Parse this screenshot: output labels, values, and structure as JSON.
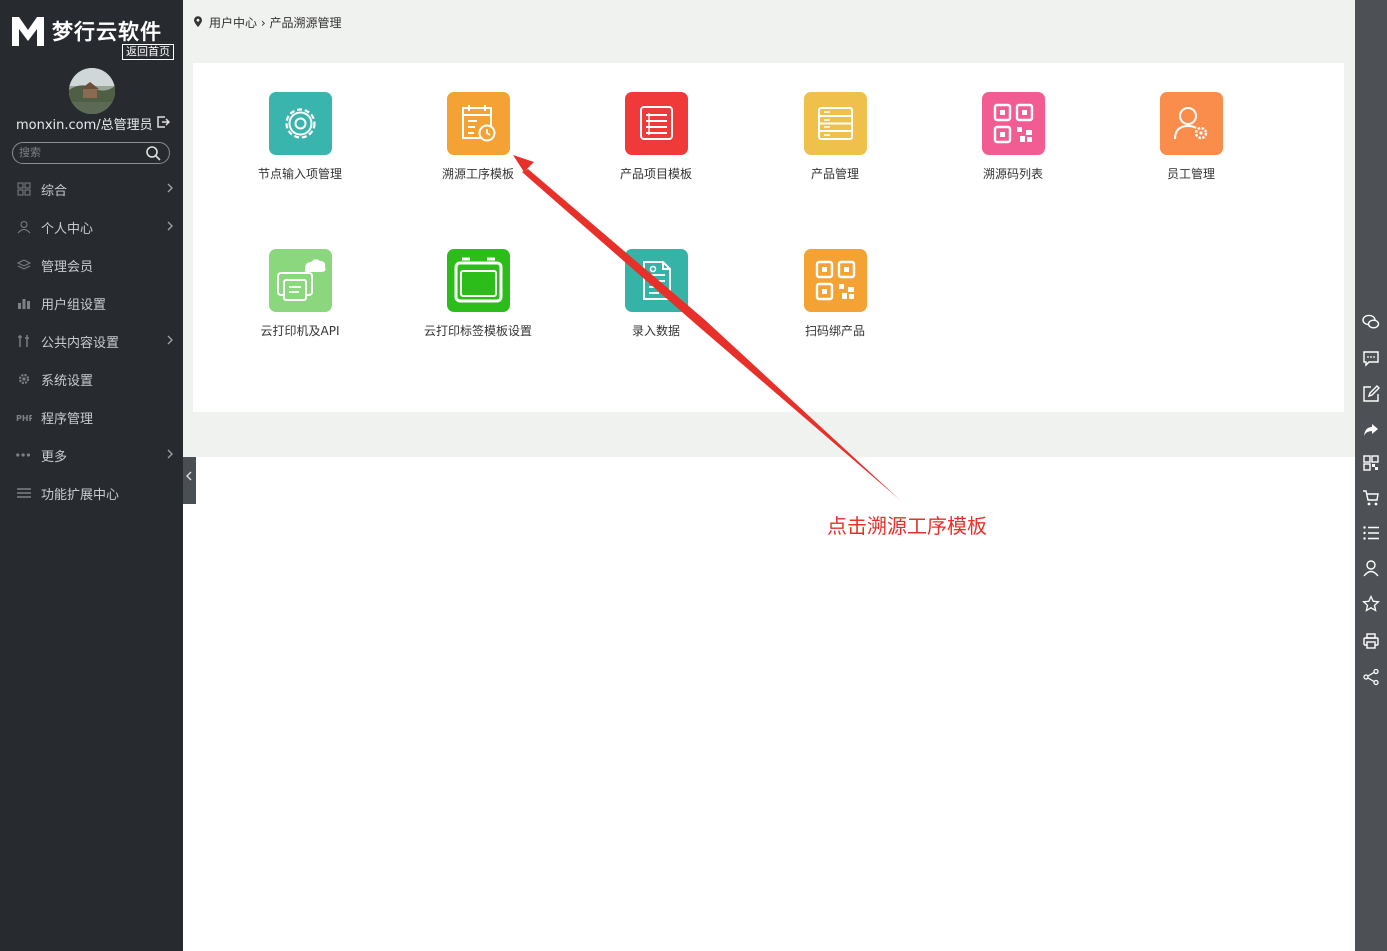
{
  "colors": {
    "sidebar_bg": "#272b2f",
    "content_bg": "#f0f2ef",
    "rightbar_bg": "#4d5054",
    "annotation_red": "#e8302a"
  },
  "sidebar": {
    "logo_text": "梦行云软件",
    "home_link": "返回首页",
    "user_label": "monxin.com/总管理员",
    "search_placeholder": "搜索",
    "menu": [
      {
        "label": "综合",
        "icon": "grid-icon",
        "has_arrow": true
      },
      {
        "label": "个人中心",
        "icon": "user-icon",
        "has_arrow": true
      },
      {
        "label": "管理会员",
        "icon": "layers-icon",
        "has_arrow": false
      },
      {
        "label": "用户组设置",
        "icon": "bar-chart-icon",
        "has_arrow": false
      },
      {
        "label": "公共内容设置",
        "icon": "tools-icon",
        "has_arrow": true
      },
      {
        "label": "系统设置",
        "icon": "gear-icon",
        "has_arrow": false
      },
      {
        "label": "程序管理",
        "icon": "php-icon",
        "has_arrow": false
      },
      {
        "label": "更多",
        "icon": "dots-icon",
        "has_arrow": true
      },
      {
        "label": "功能扩展中心",
        "icon": "hamburger-icon",
        "has_arrow": false
      }
    ]
  },
  "breadcrumb": {
    "items": [
      "用户中心",
      "产品溯源管理"
    ],
    "separator": "›"
  },
  "tiles": [
    {
      "label": "节点输入项管理",
      "color": "#3ab5ad",
      "icon": "gear-icon"
    },
    {
      "label": "溯源工序模板",
      "color": "#f3a233",
      "icon": "calendar-clock-icon"
    },
    {
      "label": "产品项目模板",
      "color": "#f03a3a",
      "icon": "list-icon"
    },
    {
      "label": "产品管理",
      "color": "#efc04c",
      "icon": "server-list-icon"
    },
    {
      "label": "溯源码列表",
      "color": "#f35c93",
      "icon": "qr-code-icon"
    },
    {
      "label": "员工管理",
      "color": "#fb8d4c",
      "icon": "user-gear-icon"
    },
    {
      "label": "云打印机及API",
      "color": "#8ad77d",
      "icon": "cloud-printer-icon"
    },
    {
      "label": "云打印标签模板设置",
      "color": "#2cbd1a",
      "icon": "label-template-icon"
    },
    {
      "label": "录入数据",
      "color": "#34b3a6",
      "icon": "document-icon"
    },
    {
      "label": "扫码绑产品",
      "color": "#f3a233",
      "icon": "qr-code-icon"
    }
  ],
  "annotation": {
    "text": "点击溯源工序模板"
  },
  "rightbar": {
    "icons": [
      "wechat-icon",
      "message-icon",
      "edit-icon",
      "share-arrow-icon",
      "qr-icon",
      "cart-icon",
      "list-icon",
      "user-icon",
      "star-icon",
      "print-icon",
      "share-icon"
    ]
  }
}
